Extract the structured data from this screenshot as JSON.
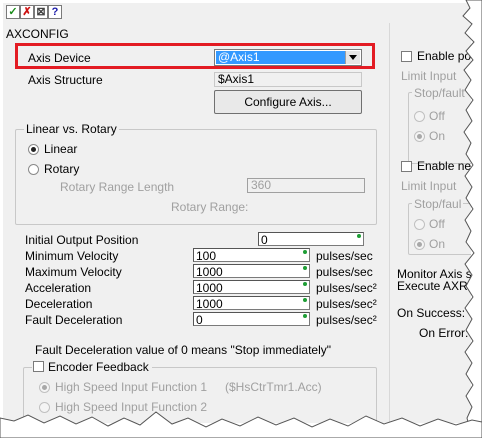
{
  "toolbar": {
    "icons": [
      {
        "name": "check-icon",
        "glyph": "✓",
        "color": "#1a8c1a"
      },
      {
        "name": "cancel-icon",
        "glyph": "✗",
        "color": "#cc1111"
      },
      {
        "name": "cancel-all-icon",
        "glyph": "⊠",
        "color": "#444444"
      },
      {
        "name": "help-icon",
        "glyph": "?",
        "color": "#1a1aa8"
      }
    ]
  },
  "title": "AXCONFIG",
  "axis_device": {
    "label": "Axis Device",
    "value": "@Axis1",
    "highlight_color": "#e31b23",
    "selection_color": "#3399ff"
  },
  "axis_structure": {
    "label": "Axis Structure",
    "value": "$Axis1"
  },
  "configure_button": "Configure Axis...",
  "linear_rotary": {
    "group_label": "Linear vs. Rotary",
    "linear": "Linear",
    "rotary": "Rotary",
    "range_length_label": "Rotary Range Length",
    "range_length_value": "360",
    "rotary_range_label": "Rotary Range:"
  },
  "params": [
    {
      "label": "Initial Output Position",
      "value": "0",
      "unit": ""
    },
    {
      "label": "Minimum Velocity",
      "value": "100",
      "unit": "pulses/sec"
    },
    {
      "label": "Maximum Velocity",
      "value": "1000",
      "unit": "pulses/sec"
    },
    {
      "label": "Acceleration",
      "value": "1000",
      "unit": "pulses/sec²"
    },
    {
      "label": "Deceleration",
      "value": "1000",
      "unit": "pulses/sec²"
    },
    {
      "label": "Fault Deceleration",
      "value": "0",
      "unit": "pulses/sec²"
    }
  ],
  "fault_note": "Fault Deceleration value of 0 means \"Stop immediately\"",
  "encoder": {
    "label": "Encoder Feedback",
    "hs1": "High Speed Input Function 1",
    "hs1_tag": "($HsCtrTmr1.Acc)",
    "hs2": "High Speed Input Function 2"
  },
  "right": {
    "enable_pos": "Enable pos",
    "limit_input": "Limit Input",
    "stop_fault": "Stop/fault",
    "stop_fault_short": "Stop/faul",
    "off": "Off",
    "on": "On",
    "enable_neg": "Enable nega",
    "monitor": "Monitor Axis st",
    "execute": "Execute AXRS",
    "on_success": "On Success:",
    "on_error": "On Error:"
  }
}
